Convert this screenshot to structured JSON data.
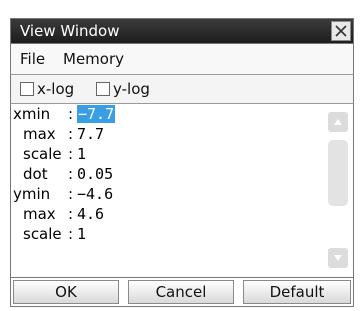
{
  "window": {
    "title": "View Window"
  },
  "menu": {
    "items": [
      {
        "label": "File"
      },
      {
        "label": "Memory"
      }
    ]
  },
  "log_options": {
    "x_log": {
      "label": "x-log",
      "checked": false
    },
    "y_log": {
      "label": "y-log",
      "checked": false
    }
  },
  "fields": [
    {
      "label": "xmin",
      "value": "−7.7",
      "selected": true
    },
    {
      "label": "max",
      "value": "7.7"
    },
    {
      "label": "scale",
      "value": "1"
    },
    {
      "label": "dot",
      "value": "0.05"
    },
    {
      "label": "ymin",
      "value": "−4.6"
    },
    {
      "label": "max",
      "value": "4.6"
    },
    {
      "label": "scale",
      "value": "1"
    }
  ],
  "colon": ":",
  "buttons": {
    "ok": "OK",
    "cancel": "Cancel",
    "default": "Default"
  },
  "colors": {
    "selection": "#3a9ee4",
    "titlebar": "#2a2a2a"
  }
}
